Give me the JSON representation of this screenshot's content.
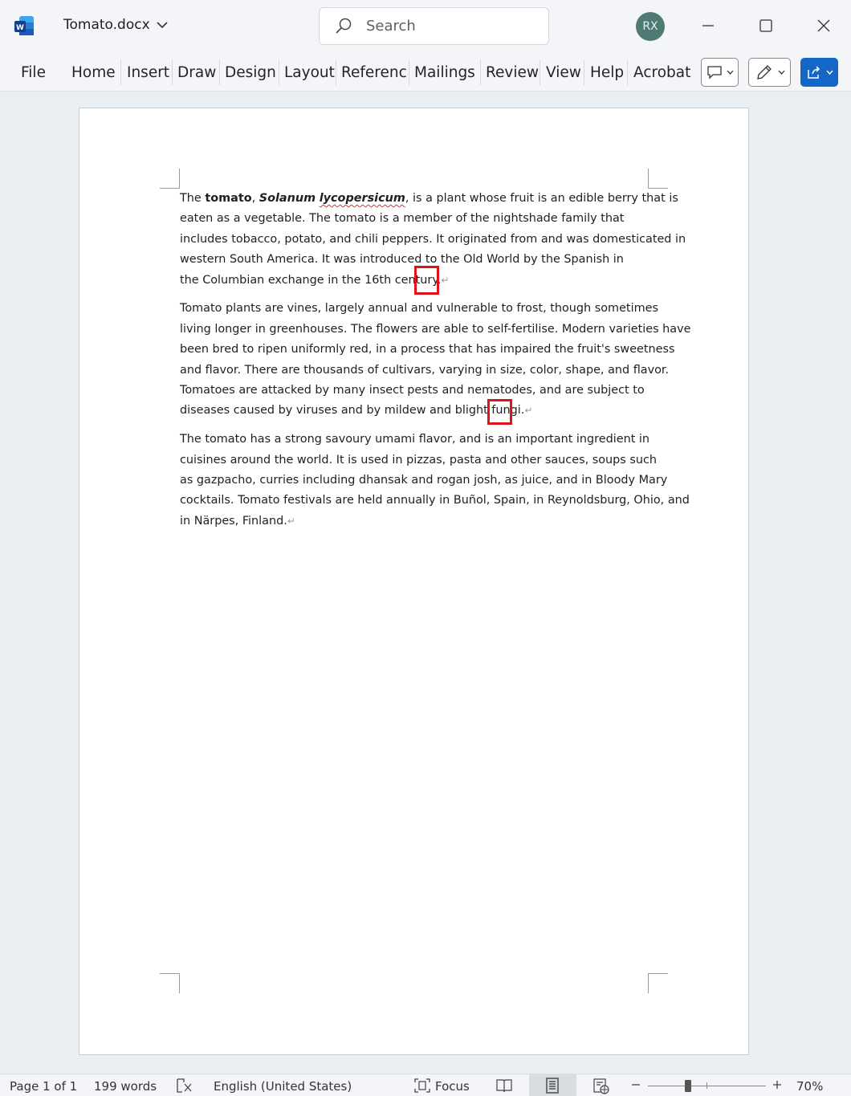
{
  "app": {
    "doc_title": "Tomato.docx",
    "user_initials": "RX"
  },
  "search": {
    "placeholder": "Search"
  },
  "ribbon": {
    "tabs": [
      "File",
      "Home",
      "Insert",
      "Draw",
      "Design",
      "Layout",
      "References",
      "Mailings",
      "Review",
      "View",
      "Help",
      "Acrobat"
    ]
  },
  "document": {
    "p1": {
      "l1_a": "The ",
      "l1_bold": "tomato",
      "l1_b": ", ",
      "l1_ital1": "Solanum",
      "l1_c": " ",
      "l1_ital2": "lycopersicum",
      "l1_d": ", is a plant whose fruit is an edible berry that is",
      "l2": "eaten as a vegetable. The tomato is a member of the nightshade family that",
      "l3": "includes tobacco, potato, and chili peppers. It originated from and was domesticated in",
      "l4": "western South America. It was introduced to the Old World by the Spanish in",
      "l5": "the Columbian exchange in the 16th century."
    },
    "p2": {
      "l1": "Tomato plants are vines, largely annual and vulnerable to frost, though sometimes",
      "l2": "living longer in greenhouses. The flowers are able to self-fertilise. Modern varieties have",
      "l3": "been bred to ripen uniformly red, in a process that has impaired the fruit's sweetness",
      "l4": "and flavor. There are thousands of cultivars, varying in size, color, shape, and flavor.",
      "l5": "Tomatoes are attacked by many insect pests and nematodes, and are subject to",
      "l6": "diseases caused by viruses and by mildew and blight fungi."
    },
    "p3": {
      "l1": "The tomato has a strong savoury umami flavor, and is an important ingredient in",
      "l2": "cuisines around the world. It is used in pizzas, pasta and other sauces, soups such",
      "l3": "as gazpacho, curries including dhansak and rogan josh, as juice, and in Bloody Mary",
      "l4": "cocktails. Tomato festivals are held annually in Buñol, Spain, in Reynoldsburg, Ohio, and",
      "l5": "in Närpes, Finland."
    },
    "pilcrow": "↵"
  },
  "status": {
    "page": "Page 1 of 1",
    "words": "199 words",
    "language": "English (United States)",
    "focus": "Focus",
    "zoom": "70%"
  },
  "colors": {
    "highlight": "#e0131d",
    "share_button": "#1467c6",
    "avatar": "#4e7a73"
  }
}
